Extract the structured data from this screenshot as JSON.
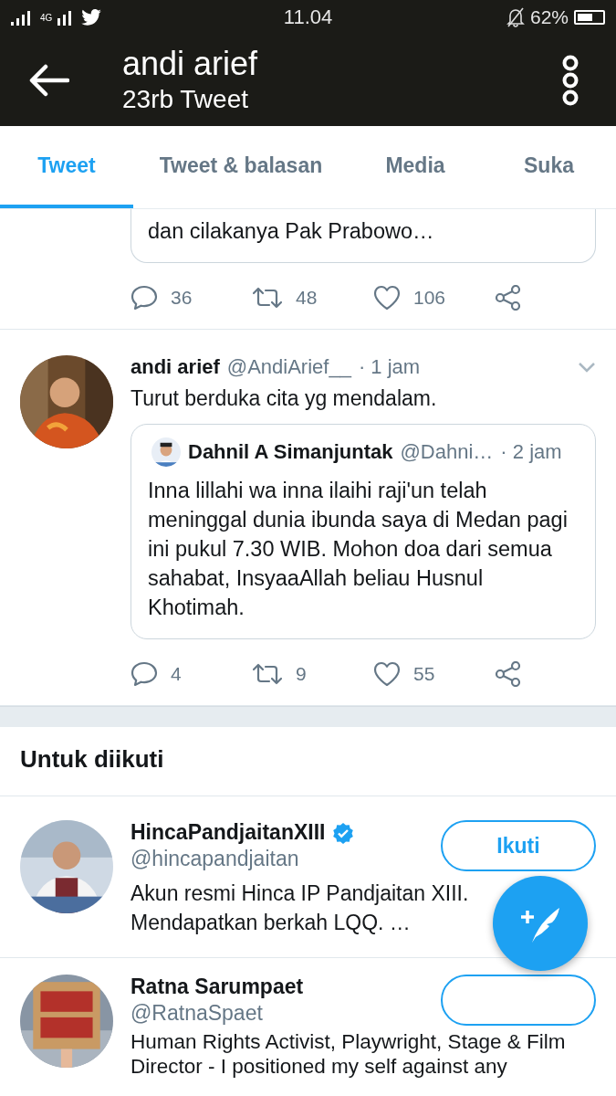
{
  "status_bar": {
    "network_label": "4G",
    "time": "11.04",
    "battery": "62%"
  },
  "header": {
    "title": "andi arief",
    "subtitle": "23rb Tweet"
  },
  "tabs": [
    {
      "label": "Tweet",
      "selected": true
    },
    {
      "label": "Tweet & balasan",
      "selected": false
    },
    {
      "label": "Media",
      "selected": false
    },
    {
      "label": "Suka",
      "selected": false
    }
  ],
  "tweets": [
    {
      "quote": {
        "text": "dan cilakanya Pak Prabowo…"
      },
      "stats": {
        "replies": "36",
        "retweets": "48",
        "likes": "106"
      }
    },
    {
      "author": "andi arief",
      "handle": "@AndiArief__",
      "time": "· 1 jam",
      "text": "Turut berduka cita yg mendalam.",
      "quote": {
        "author": "Dahnil A Simanjuntak",
        "handle": "@Dahni…",
        "time": "· 2 jam",
        "text": "Inna lillahi wa inna ilaihi raji'un telah meninggal dunia ibunda saya di Medan pagi ini pukul 7.30 WIB. Mohon doa dari semua sahabat, InsyaaAllah beliau Husnul Khotimah."
      },
      "stats": {
        "replies": "4",
        "retweets": "9",
        "likes": "55"
      }
    }
  ],
  "suggestions": {
    "title": "Untuk diikuti",
    "users": [
      {
        "name": "HincaPandjaitanXIII",
        "verified": true,
        "handle": "@hincapandjaitan",
        "follow_label": "Ikuti",
        "bio": "Akun resmi Hinca IP Pandjaitan XIII. Mendapatkan berkah LQQ. …"
      },
      {
        "name": "Ratna Sarumpaet",
        "verified": false,
        "handle": "@RatnaSpaet",
        "bio": "Human Rights Activist, Playwright, Stage & Film Director - I positioned my self against any"
      }
    ]
  }
}
